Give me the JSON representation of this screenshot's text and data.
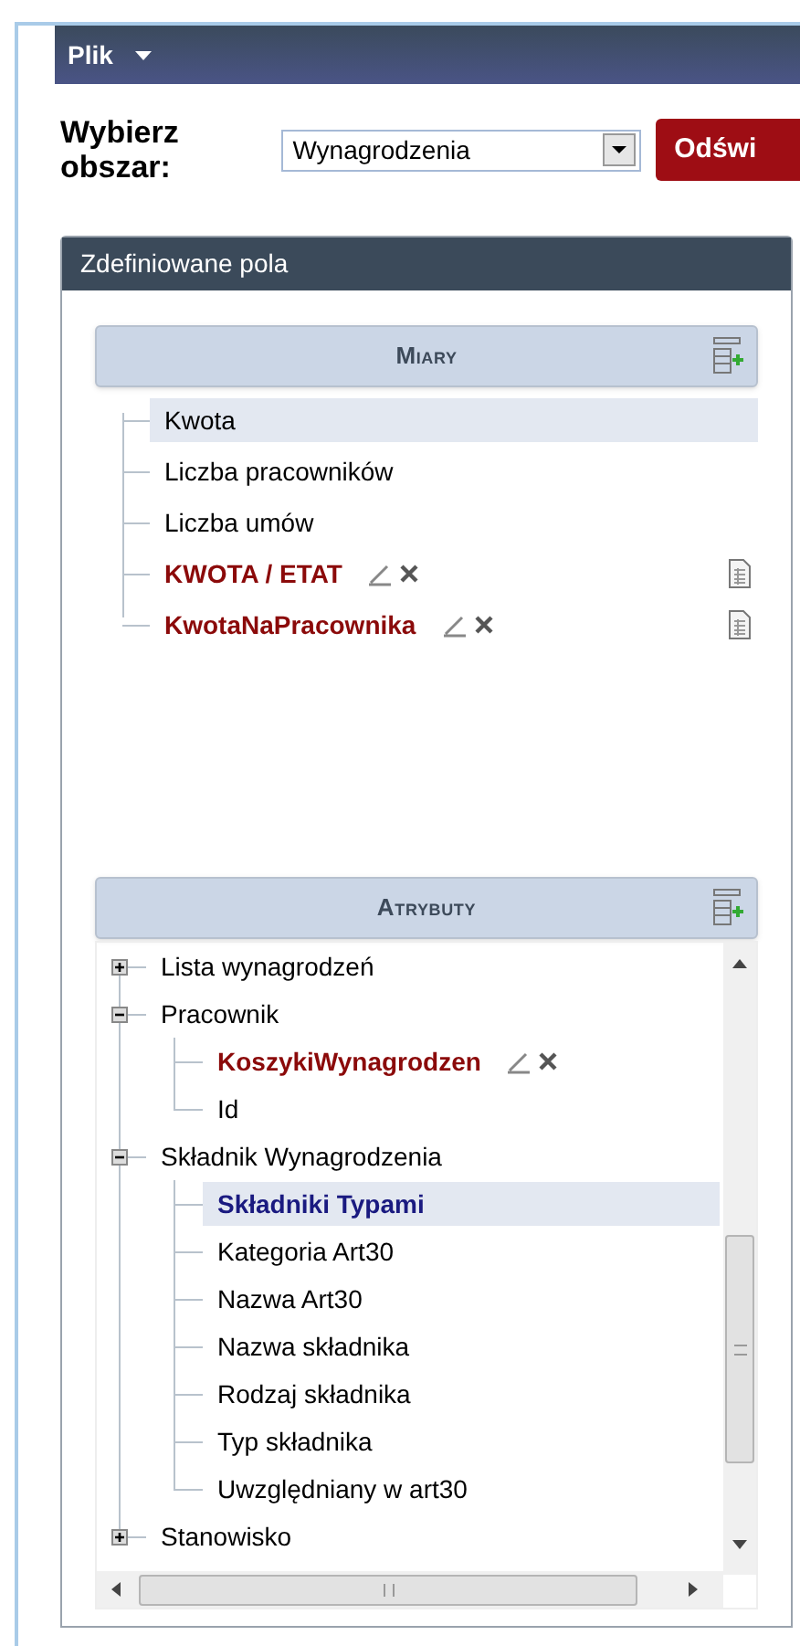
{
  "menu": {
    "label": "Plik"
  },
  "area_picker": {
    "label": "Wybierz obszar:",
    "value": "Wynagrodzenia",
    "button": "Odświ"
  },
  "panel": {
    "title": "Zdefiniowane pola",
    "measures": {
      "title": "Miary",
      "items": [
        {
          "label": "Kwota",
          "kind": "field",
          "selected": true
        },
        {
          "label": "Liczba pracowników",
          "kind": "field",
          "selected": false
        },
        {
          "label": "Liczba umów",
          "kind": "field",
          "selected": false
        },
        {
          "label": "KWOTA / ETAT",
          "kind": "calculated",
          "selected": false
        },
        {
          "label": "KwotaNaPracownika",
          "kind": "calculated",
          "selected": false
        }
      ]
    },
    "attributes": {
      "title": "Atrybuty",
      "items": [
        {
          "label": "Lista wynagrodzeń",
          "expanded": false,
          "selected": false
        },
        {
          "label": "Pracownik",
          "expanded": true,
          "selected": false,
          "children": [
            {
              "label": "KoszykiWynagrodzen",
              "kind": "custom",
              "selected": false
            },
            {
              "label": "Id",
              "kind": "field",
              "selected": false
            }
          ]
        },
        {
          "label": "Składnik Wynagrodzenia",
          "expanded": true,
          "selected": false,
          "children": [
            {
              "label": "Składniki Typami",
              "kind": "grouping",
              "selected": true
            },
            {
              "label": "Kategoria Art30",
              "kind": "field",
              "selected": false
            },
            {
              "label": "Nazwa Art30",
              "kind": "field",
              "selected": false
            },
            {
              "label": "Nazwa składnika",
              "kind": "field",
              "selected": false
            },
            {
              "label": "Rodzaj składnika",
              "kind": "field",
              "selected": false
            },
            {
              "label": "Typ składnika",
              "kind": "field",
              "selected": false
            },
            {
              "label": "Uwzględniany w art30",
              "kind": "field",
              "selected": false
            }
          ]
        },
        {
          "label": "Stanowisko",
          "expanded": false,
          "selected": false
        }
      ]
    }
  }
}
